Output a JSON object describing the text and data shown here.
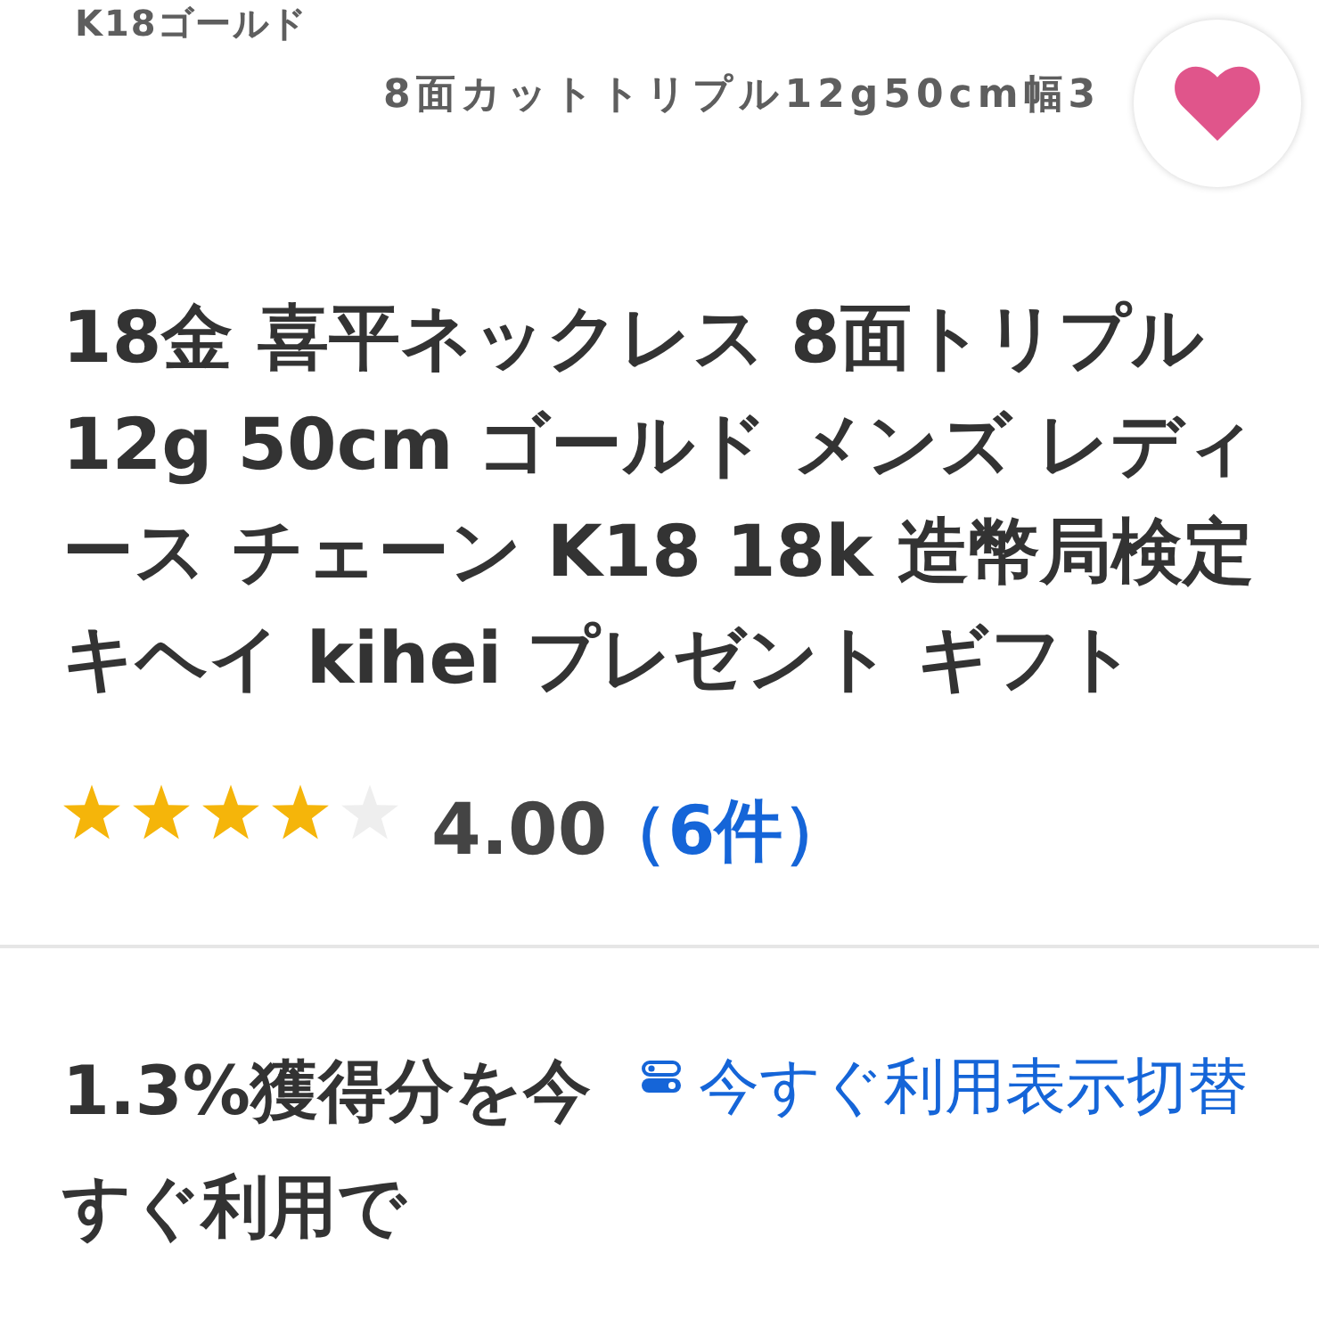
{
  "product_image": {
    "captions": [
      "K18ゴールド",
      "8面カットトリプル12g50cm幅3"
    ]
  },
  "title": "18金 喜平ネックレス 8面トリプル 12g 50cm ゴールド メンズ レディース チェーン K18 18k 造幣局検定キヘイ kihei プレゼント ギフト",
  "rating": {
    "stars": 4,
    "score": "4.00",
    "count": "（6件）"
  },
  "points": {
    "text": "1.3%獲得分を今すぐ利用で",
    "toggle_link": "今すぐ利用表示切替"
  }
}
